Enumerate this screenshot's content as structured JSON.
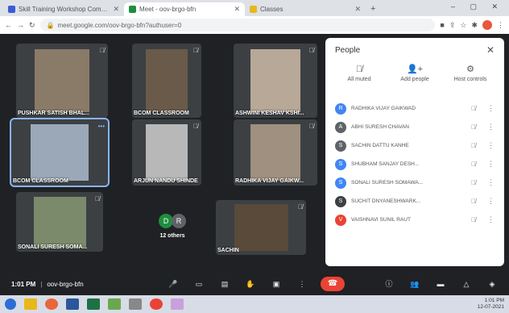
{
  "browser": {
    "tabs": [
      {
        "title": "Skill Training Workshop Comm...",
        "color": "#3a5ad8",
        "active": false
      },
      {
        "title": "Meet - oov-brgo-bfn",
        "color": "#1e8e3e",
        "active": true
      },
      {
        "title": "Classes",
        "color": "#e8b71a",
        "active": false
      }
    ],
    "address": "meet.google.com/oov-brgo-bfn?authuser=0"
  },
  "tiles": [
    {
      "name": "PUSHKAR SATISH BHAL...",
      "muted": true,
      "highlight": false
    },
    {
      "name": "BCOM CLASSROOM",
      "muted": true,
      "highlight": false
    },
    {
      "name": "ASHWINI KESHAV KSHI...",
      "muted": true,
      "highlight": false
    },
    {
      "name": "BCOM CLASSROOM",
      "muted": false,
      "highlight": true
    },
    {
      "name": "ARJUN NANDU SHINDE",
      "muted": true,
      "highlight": false
    },
    {
      "name": "RADHIKA VIJAY GAIKW...",
      "muted": true,
      "highlight": false
    },
    {
      "name": "SONALI SURESH SOMA...",
      "muted": true,
      "highlight": false
    },
    {
      "name": "SACHIN",
      "muted": true,
      "highlight": false
    }
  ],
  "others": {
    "label": "12 others",
    "avatars": [
      {
        "letter": "D",
        "color": "#1e8e3e"
      },
      {
        "letter": "R",
        "color": "#5f6368"
      }
    ]
  },
  "people_panel": {
    "title": "People",
    "actions": [
      {
        "label": "All muted",
        "icon": "mic-off-icon"
      },
      {
        "label": "Add people",
        "icon": "add-person-icon"
      },
      {
        "label": "Host controls",
        "icon": "host-controls-icon"
      }
    ],
    "people": [
      {
        "name": "RADHIKA VIJAY GAIKWAD",
        "initial": "R",
        "color": "#4285f4"
      },
      {
        "name": "ABHI SURESH CHAVAN",
        "initial": "A",
        "color": "#5f6368"
      },
      {
        "name": "SACHIN DATTU KANHE",
        "initial": "S",
        "color": "#5f6368"
      },
      {
        "name": "SHUBHAM SANJAY DESH...",
        "initial": "S",
        "color": "#4285f4"
      },
      {
        "name": "SONALI SURESH SOMAWA...",
        "initial": "S",
        "color": "#4285f4"
      },
      {
        "name": "SUCHIT DNYANESHWARK...",
        "initial": "S",
        "color": "#3c4043"
      },
      {
        "name": "VAISHNAVI SUNIL RAUT",
        "initial": "V",
        "color": "#ea4335"
      }
    ]
  },
  "bottom": {
    "time": "1:01 PM",
    "code": "oov-brgo-bfn"
  },
  "tray": {
    "time": "1:01 PM",
    "date": "12-07-2021"
  }
}
